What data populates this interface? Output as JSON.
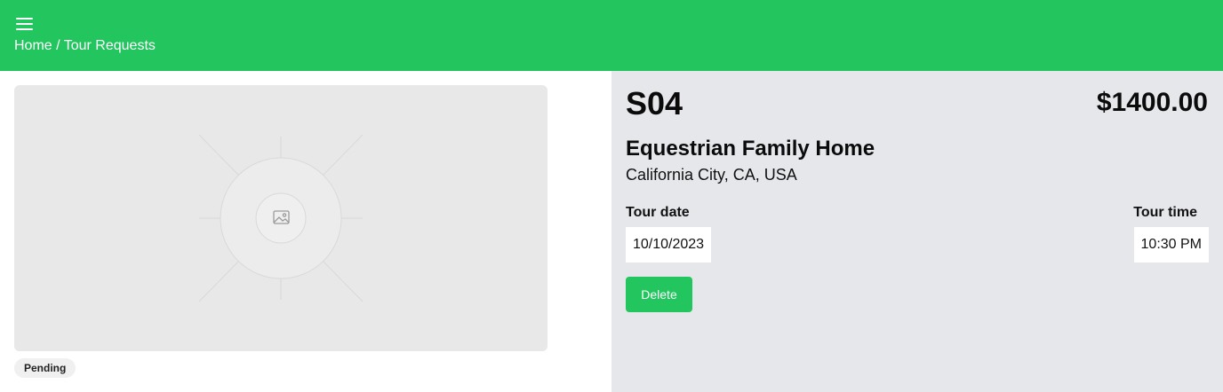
{
  "header": {
    "menu_icon": "hamburger-menu-icon",
    "breadcrumb": {
      "home": "Home",
      "separator": " / ",
      "current": "Tour Requests"
    },
    "background_color": "#22c55e"
  },
  "listing": {
    "image_icon": "image-placeholder-icon",
    "status": "Pending",
    "code": "S04",
    "price": "$1400.00",
    "title": "Equestrian Family Home",
    "location": "California City, CA, USA",
    "tour_date_label": "Tour date",
    "tour_date": "10/10/2023",
    "tour_time_label": "Tour time",
    "tour_time": "10:30 PM",
    "delete_label": "Delete"
  },
  "colors": {
    "accent": "#22c55e",
    "panel": "#e5e7eb"
  }
}
